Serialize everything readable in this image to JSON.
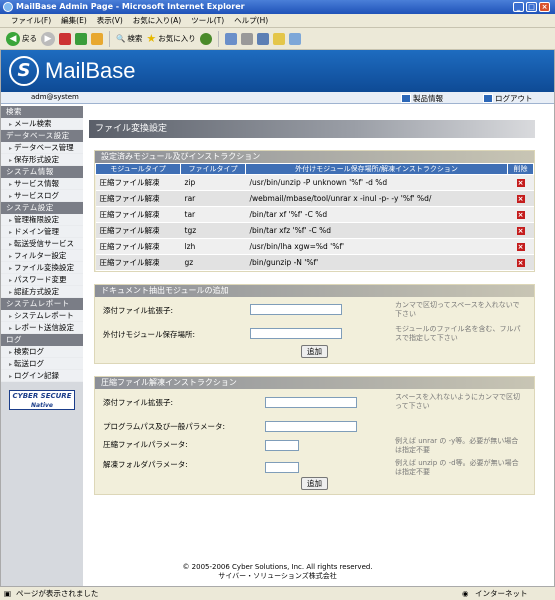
{
  "window": {
    "title": "MailBase Admin Page - Microsoft Internet Explorer"
  },
  "menu": [
    "ファイル(F)",
    "編集(E)",
    "表示(V)",
    "お気に入り(A)",
    "ツール(T)",
    "ヘルプ(H)"
  ],
  "toolbar": {
    "back": "戻る",
    "search": "検索",
    "favorites": "お気に入り"
  },
  "header": {
    "logo": "MailBase",
    "user": "adm@system",
    "product_info": "製品情報",
    "logout": "ログアウト"
  },
  "sidebar": [
    {
      "heading": "検索",
      "items": [
        "メール検索"
      ]
    },
    {
      "heading": "データベース設定",
      "items": [
        "データベース管理",
        "保存形式設定"
      ]
    },
    {
      "heading": "システム情報",
      "items": [
        "サービス情報",
        "サービスログ"
      ]
    },
    {
      "heading": "システム設定",
      "items": [
        "管理権限設定",
        "ドメイン管理",
        "転送受信サービス",
        "フィルター設定",
        "ファイル変換設定",
        "パスワード変更",
        "認証方式設定"
      ]
    },
    {
      "heading": "システムレポート",
      "items": [
        "システムレポート",
        "レポート送信設定"
      ]
    },
    {
      "heading": "ログ",
      "items": [
        "検索ログ",
        "転送ログ",
        "ログイン記録"
      ]
    }
  ],
  "badge": {
    "line1": "CYBER SECURE",
    "line2": "Native"
  },
  "page_title": "ファイル変換設定",
  "section1": {
    "title": "設定済みモジュール及びインストラクション",
    "headers": [
      "モジュールタイプ",
      "ファイルタイプ",
      "外付けモジュール保存場所/解凍インストラクション",
      "削除"
    ],
    "rows": [
      {
        "type": "圧縮ファイル解凍",
        "ext": "zip",
        "cmd": "/usr/bin/unzip -P unknown '%f' -d %d"
      },
      {
        "type": "圧縮ファイル解凍",
        "ext": "rar",
        "cmd": "/webmail/mbase/tool/unrar x -inul -p- -y '%f' %d/"
      },
      {
        "type": "圧縮ファイル解凍",
        "ext": "tar",
        "cmd": "/bin/tar xf '%f' -C %d"
      },
      {
        "type": "圧縮ファイル解凍",
        "ext": "tgz",
        "cmd": "/bin/tar xfz '%f' -C %d"
      },
      {
        "type": "圧縮ファイル解凍",
        "ext": "lzh",
        "cmd": "/usr/bin/lha xgw=%d '%f'"
      },
      {
        "type": "圧縮ファイル解凍",
        "ext": "gz",
        "cmd": "/bin/gunzip -N '%f'"
      }
    ]
  },
  "section2": {
    "title": "ドキュメント抽出モジュールの追加",
    "label_ext": "添付ファイル拡張子:",
    "hint_ext": "カンマで区切ってスペースを入れないで下さい",
    "label_path": "外付けモジュール保存場所:",
    "hint_path": "モジュールのファイル名を含む、フルパスで指定して下さい",
    "add": "追加"
  },
  "section3": {
    "title": "圧縮ファイル解凍インストラクション",
    "label_ext": "添付ファイル拡張子:",
    "hint_ext": "スペースを入れないようにカンマで区切って下さい",
    "label_prog": "プログラムパス及び一般パラメータ:",
    "label_fparam": "圧縮ファイルパラメータ:",
    "hint_fparam": "例えば unrar の -y等。必要が無い場合は指定不要",
    "label_dparam": "解凍フォルダパラメータ:",
    "hint_dparam": "例えば unzip の -d等。必要が無い場合は指定不要",
    "add": "追加"
  },
  "footer": {
    "line1": "© 2005-2006 Cyber Solutions, Inc. All rights reserved.",
    "line2": "サイバー・ソリューションズ株式会社"
  },
  "status": {
    "left": "ページが表示されました",
    "right": "インターネット"
  }
}
